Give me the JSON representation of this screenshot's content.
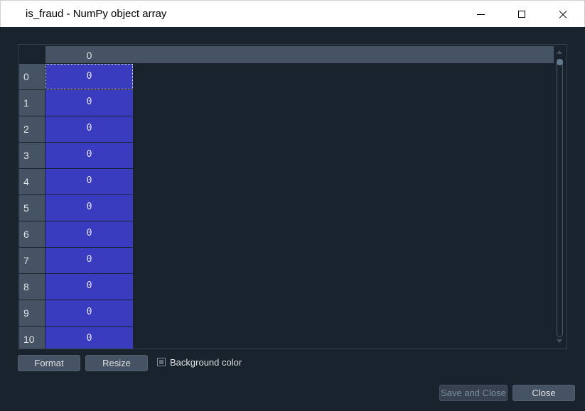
{
  "window": {
    "title": "is_fraud - NumPy object array"
  },
  "table": {
    "column_header": "0",
    "rows": [
      {
        "index": "0",
        "value": "0"
      },
      {
        "index": "1",
        "value": "0"
      },
      {
        "index": "2",
        "value": "0"
      },
      {
        "index": "3",
        "value": "0"
      },
      {
        "index": "4",
        "value": "0"
      },
      {
        "index": "5",
        "value": "0"
      },
      {
        "index": "6",
        "value": "0"
      },
      {
        "index": "7",
        "value": "0"
      },
      {
        "index": "8",
        "value": "0"
      },
      {
        "index": "9",
        "value": "0"
      },
      {
        "index": "10",
        "value": "0"
      }
    ],
    "selected_row": 0
  },
  "toolbar": {
    "format_label": "Format",
    "resize_label": "Resize",
    "background_color_label": "Background color",
    "background_color_checked": "partial"
  },
  "footer": {
    "save_close_label": "Save and Close",
    "close_label": "Close"
  },
  "colors": {
    "background": "#19232d",
    "header": "#455364",
    "cell": "#3a3cc0",
    "text": "#e0e1e3"
  }
}
